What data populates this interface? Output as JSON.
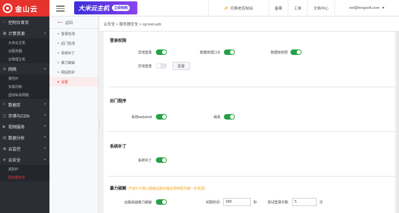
{
  "header": {
    "logo": "金山云",
    "banner": "大米云主机",
    "banner_tag": "立即抢购",
    "console": "切换老控制台",
    "beian": "备案",
    "ticket": "工单",
    "docs": "文档中心",
    "account": "net@kingsoft.com"
  },
  "sidebar": {
    "groups": [
      {
        "label": "控制台首页"
      },
      {
        "label": "计算资源"
      },
      {
        "label": "网络"
      },
      {
        "label": "数据库"
      },
      {
        "label": "存储与CDN"
      },
      {
        "label": "视频服务"
      },
      {
        "label": "数据分析"
      },
      {
        "label": "云监控"
      },
      {
        "label": "云安全"
      }
    ],
    "compute_items": [
      "大米云主机",
      "云服务器",
      "云物理主机"
    ],
    "network_items": [
      "弹性IP",
      "负载均衡",
      "虚拟私有网络"
    ],
    "security_items": [
      "高防IP",
      "服务器安全"
    ]
  },
  "subnav": {
    "back": "返回",
    "items": [
      "登录检测",
      "后门检测",
      "系统补丁",
      "暴力破解",
      "网站防护",
      "设置"
    ]
  },
  "breadcrumb": "云安全 > 服务器安全 > cg-test-azb",
  "login": {
    "title": "登录权限",
    "remote_login": "异地登录",
    "db_weak_pwd": "数据库弱口令",
    "db_audit": "数据库权限",
    "abnormal_login": "异地登录",
    "config_btn": "配置"
  },
  "backdoor": {
    "title": "后门程序",
    "webshell": "系统webshell",
    "virus": "病毒"
  },
  "patch": {
    "title": "系统补丁",
    "label": "系统补丁"
  },
  "bruteforce": {
    "title": "暴力破解",
    "hint": "(开启FTP暴力破解后服务器会限制服务器一定资源)",
    "label": "远程桌面暴力破解",
    "interval_label": "间隔时间:",
    "interval_value": "600",
    "interval_unit": "秒",
    "attempts_label": "尝试登录次数:",
    "attempts_value": "5",
    "attempts_unit": "次"
  },
  "colors": {
    "brand": "#e5322d",
    "switch_on": "#25a245",
    "sidebar_bg": "#2b2e35"
  }
}
